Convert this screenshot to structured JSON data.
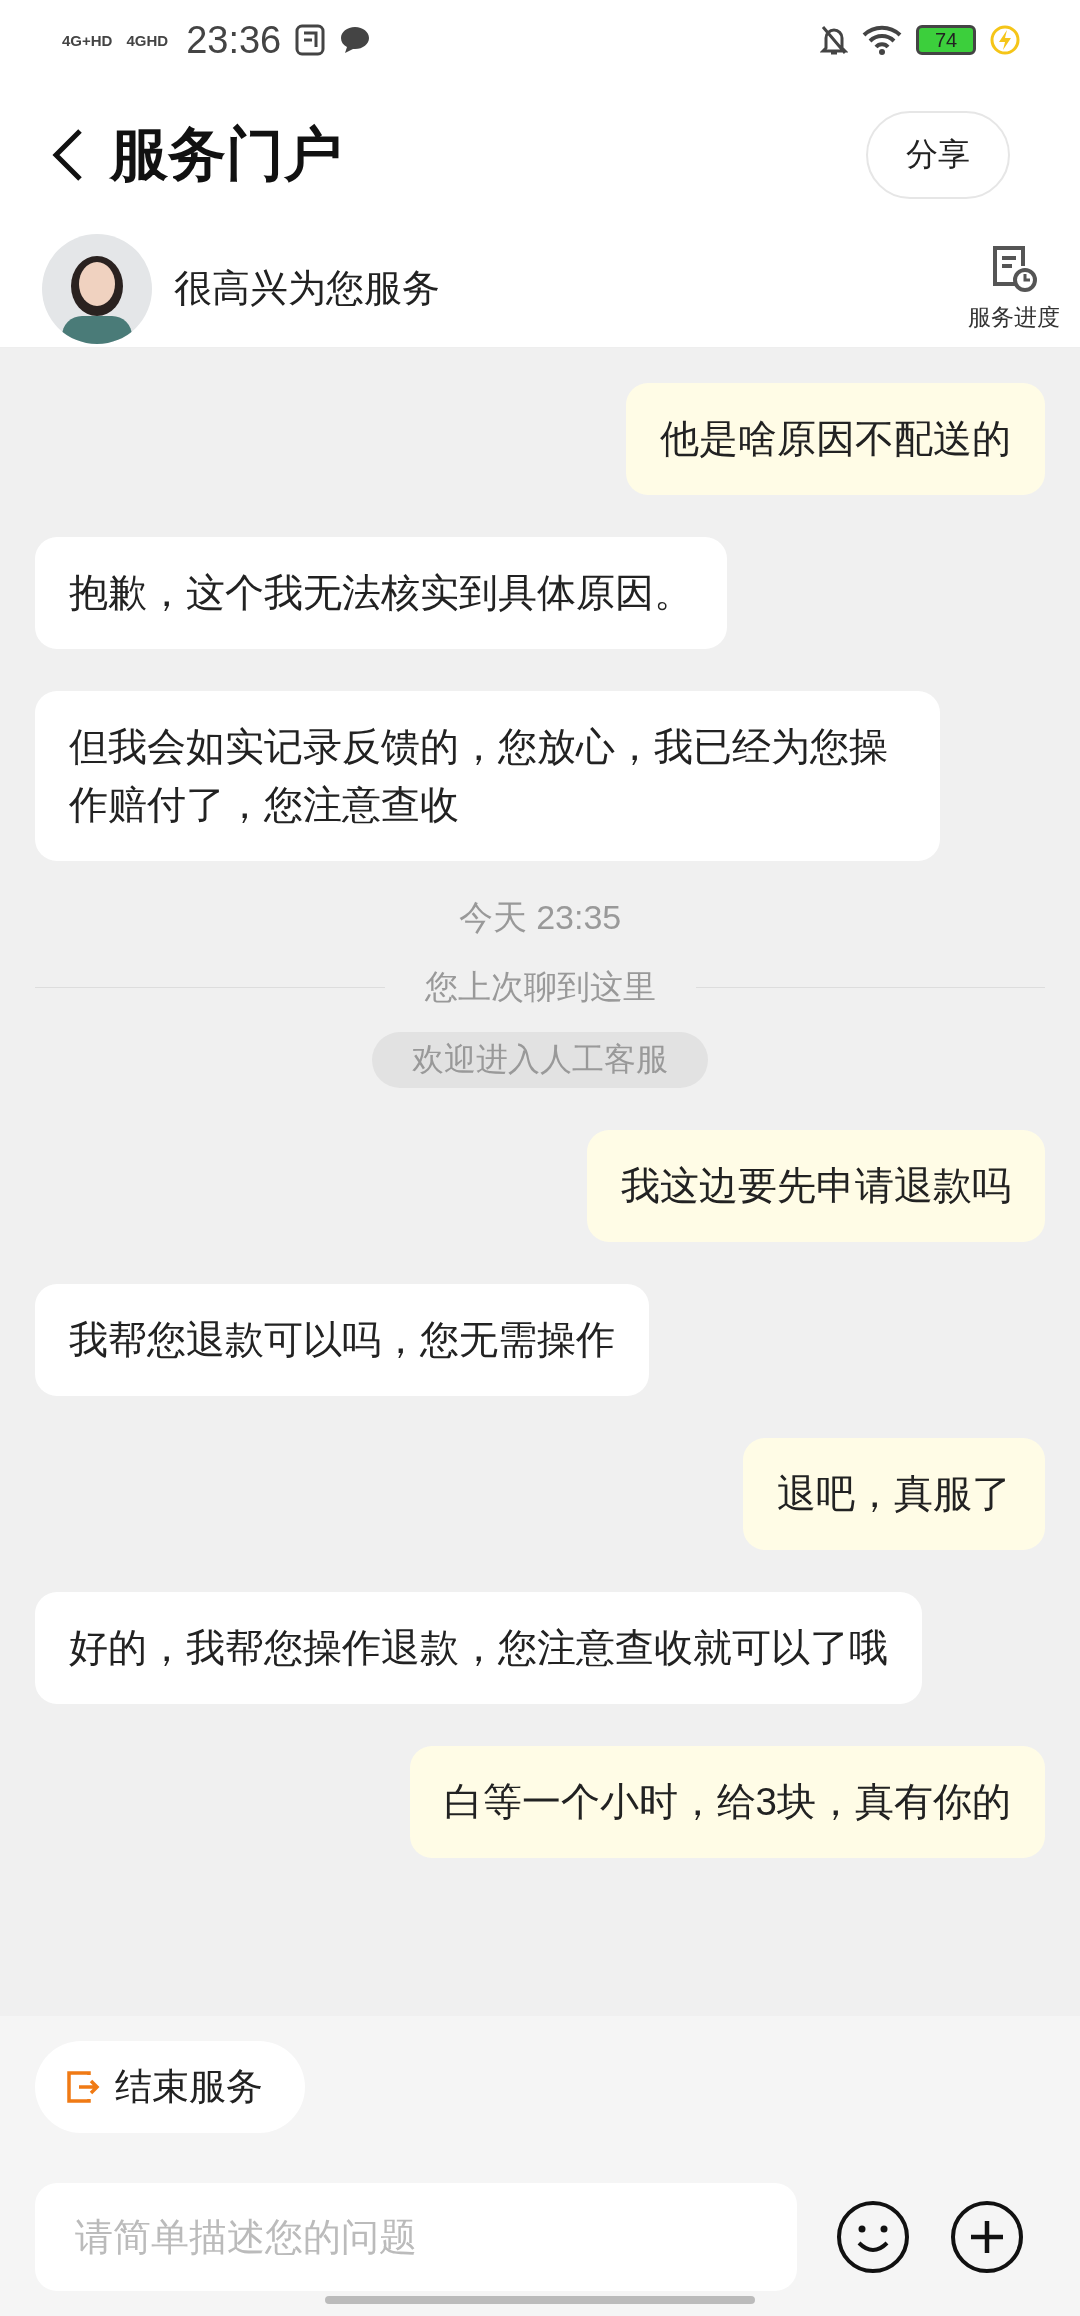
{
  "status_bar": {
    "network_1": "4G+HD",
    "network_2": "4GHD",
    "time": "23:36",
    "battery": "74"
  },
  "header": {
    "title": "服务门户",
    "share": "分享"
  },
  "agent_bar": {
    "greeting": "很高兴为您服务",
    "progress": "服务进度"
  },
  "messages": [
    {
      "kind": "user",
      "text": "他是啥原因不配送的"
    },
    {
      "kind": "agent",
      "text": "抱歉，这个我无法核实到具体原因。"
    },
    {
      "kind": "agent",
      "text": "但我会如实记录反馈的，您放心，我已经为您操作赔付了，您注意查收"
    },
    {
      "kind": "time",
      "text": "今天 23:35"
    },
    {
      "kind": "divider",
      "text": "您上次聊到这里"
    },
    {
      "kind": "notice",
      "text": "欢迎进入人工客服"
    },
    {
      "kind": "user",
      "text": "我这边要先申请退款吗"
    },
    {
      "kind": "agent",
      "text": "我帮您退款可以吗，您无需操作"
    },
    {
      "kind": "user",
      "text": "退吧，真服了"
    },
    {
      "kind": "agent",
      "text": "好的，我帮您操作退款，您注意查收就可以了哦"
    },
    {
      "kind": "user",
      "text": "白等一个小时，给3块，真有你的"
    }
  ],
  "end_service": "结束服务",
  "input": {
    "placeholder": "请简单描述您的问题"
  }
}
